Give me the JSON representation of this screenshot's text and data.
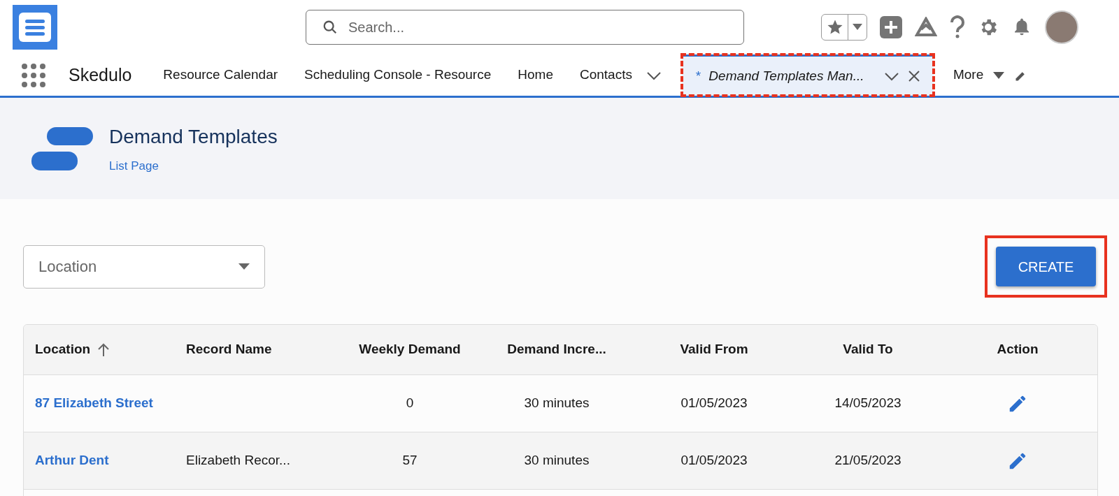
{
  "search": {
    "placeholder": "Search..."
  },
  "app_name": "Skedulo",
  "nav_tabs": [
    {
      "label": "Resource Calendar",
      "selected": false,
      "dropdown": false,
      "closable": false,
      "unsaved": false,
      "highlighted": false
    },
    {
      "label": "Scheduling Console - Resource",
      "selected": false,
      "dropdown": false,
      "closable": false,
      "unsaved": false,
      "highlighted": false
    },
    {
      "label": "Home",
      "selected": false,
      "dropdown": false,
      "closable": false,
      "unsaved": false,
      "highlighted": false
    },
    {
      "label": "Contacts",
      "selected": false,
      "dropdown": true,
      "closable": false,
      "unsaved": false,
      "highlighted": false
    },
    {
      "label": "Demand Templates Man...",
      "selected": true,
      "dropdown": true,
      "closable": true,
      "unsaved": true,
      "unsaved_mark": "*",
      "highlighted": true
    }
  ],
  "more": {
    "label": "More"
  },
  "page_header": {
    "title": "Demand Templates",
    "subtitle": "List Page"
  },
  "location_filter": {
    "placeholder": "Location"
  },
  "create_button": {
    "label": "CREATE",
    "highlighted": true
  },
  "table": {
    "columns": [
      {
        "label": "Location",
        "sorted": true
      },
      {
        "label": "Record Name",
        "sorted": false
      },
      {
        "label": "Weekly Demand",
        "sorted": false
      },
      {
        "label": "Demand Incre...",
        "sorted": false
      },
      {
        "label": "Valid From",
        "sorted": false
      },
      {
        "label": "Valid To",
        "sorted": false
      },
      {
        "label": "Action",
        "sorted": false
      }
    ],
    "rows": [
      {
        "location": "87 Elizabeth Street",
        "weekly_demand": "0",
        "demand_increment": "30 minutes",
        "valid_from": "01/05/2023",
        "valid_to": "14/05/2023"
      },
      {
        "location": "Arthur Dent",
        "record_name": "Elizabeth Recor...",
        "weekly_demand": "57",
        "demand_increment": "30 minutes",
        "valid_from": "01/05/2023",
        "valid_to": "21/05/2023"
      }
    ]
  }
}
